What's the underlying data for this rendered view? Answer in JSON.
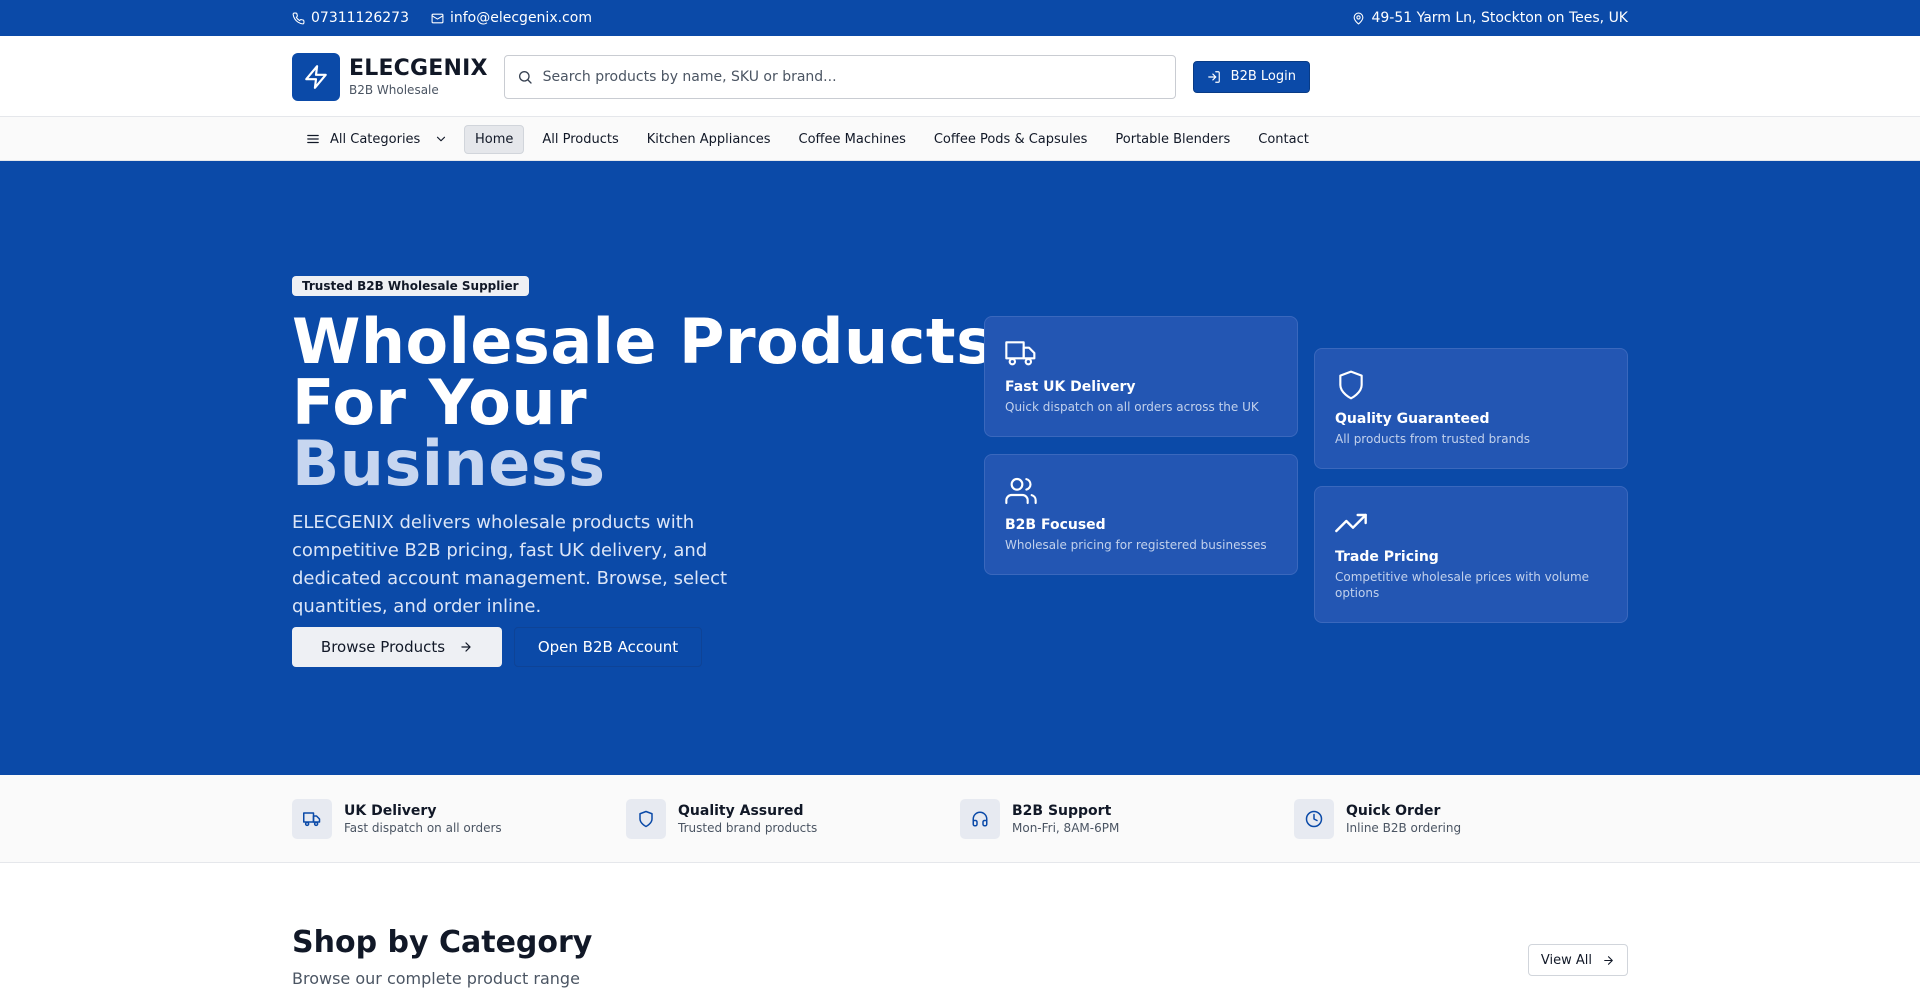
{
  "topbar": {
    "phone": "07311126273",
    "email": "info@elecgenix.com",
    "address": "49-51 Yarm Ln, Stockton on Tees, UK"
  },
  "header": {
    "brand": "ELECGENIX",
    "tagline": "B2B Wholesale",
    "search_placeholder": "Search products by name, SKU or brand...",
    "login_label": "B2B Login"
  },
  "nav": {
    "categories_label": "All Categories",
    "links": [
      "Home",
      "All Products",
      "Kitchen Appliances",
      "Coffee Machines",
      "Coffee Pods & Capsules",
      "Portable Blenders",
      "Contact"
    ],
    "active": "Home"
  },
  "hero": {
    "badge": "Trusted B2B Wholesale Supplier",
    "title_line1": "Wholesale Products",
    "title_line2": "For Your",
    "title_line3": "Business",
    "description": "ELECGENIX delivers wholesale products with competitive B2B pricing, fast UK delivery, and dedicated account management. Browse, select quantities, and order inline.",
    "primary_button": "Browse Products",
    "secondary_button": "Open B2B Account",
    "features": [
      {
        "title": "Fast UK Delivery",
        "desc": "Quick dispatch on all orders across the UK",
        "icon": "truck-icon"
      },
      {
        "title": "Quality Guaranteed",
        "desc": "All products from trusted brands",
        "icon": "shield-icon"
      },
      {
        "title": "B2B Focused",
        "desc": "Wholesale pricing for registered businesses",
        "icon": "users-icon"
      },
      {
        "title": "Trade Pricing",
        "desc": "Competitive wholesale prices with volume options",
        "icon": "trending-up-icon"
      }
    ]
  },
  "strip": [
    {
      "title": "UK Delivery",
      "sub": "Fast dispatch on all orders",
      "icon": "truck-icon"
    },
    {
      "title": "Quality Assured",
      "sub": "Trusted brand products",
      "icon": "shield-icon"
    },
    {
      "title": "B2B Support",
      "sub": "Mon-Fri, 8AM-6PM",
      "icon": "headphones-icon"
    },
    {
      "title": "Quick Order",
      "sub": "Inline B2B ordering",
      "icon": "clock-icon"
    }
  ],
  "category_section": {
    "title": "Shop by Category",
    "subtitle": "Browse our complete product range",
    "view_all": "View All"
  },
  "colors": {
    "brand_blue": "#0b4aa8",
    "hero_accent_text": "#c7d6f0"
  }
}
